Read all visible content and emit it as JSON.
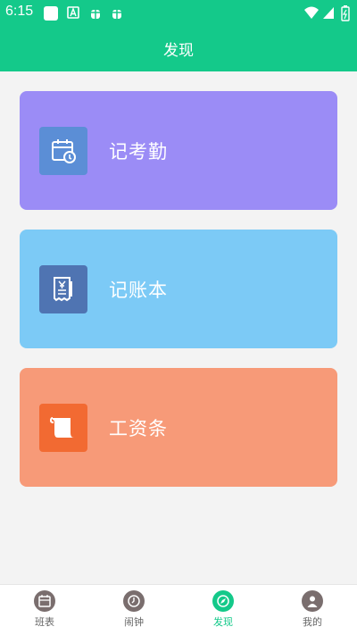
{
  "status_bar": {
    "time": "6:15"
  },
  "header": {
    "title": "发现"
  },
  "cards": [
    {
      "label": "记考勤",
      "color": "#9b8cf6",
      "icon": "calendar-clock-icon"
    },
    {
      "label": "记账本",
      "color": "#7ccaf6",
      "icon": "receipt-yen-icon"
    },
    {
      "label": "工资条",
      "color": "#f79a78",
      "icon": "payslip-scroll-icon"
    }
  ],
  "tabs": [
    {
      "label": "班表",
      "icon": "schedule-icon",
      "active": false
    },
    {
      "label": "闹钟",
      "icon": "clock-icon",
      "active": false
    },
    {
      "label": "发现",
      "icon": "compass-icon",
      "active": true
    },
    {
      "label": "我的",
      "icon": "user-icon",
      "active": false
    }
  ],
  "colors": {
    "accent": "#14c98a"
  }
}
